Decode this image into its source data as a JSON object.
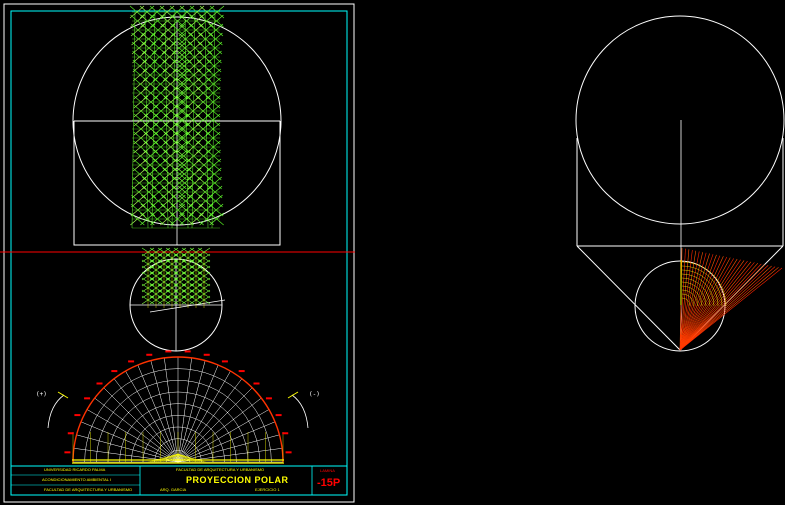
{
  "title_block": {
    "university": "UNIVERSIDAD RICARDO PALMA",
    "course": "ACONDICIONAMIENTO AMBIENTAL I",
    "faculty_line": "FACULTAD DE ARQUITECTURA Y URBANISMO",
    "drawing_title": "PROYECCION POLAR",
    "student_label": "ALUMNO",
    "subject_line": "EJERCICIO 1",
    "sheet_label": "LAMINA",
    "sheet_value": "-15P",
    "author_label": "ARQ. GARCIA"
  },
  "side_labels": {
    "left": "(+)",
    "right": "(-)"
  },
  "colors": {
    "background": "#000000",
    "frame": "#00ffff",
    "line": "#ffffff",
    "mesh": "#66ff33",
    "axis": "#ff0000",
    "arc_yellow": "#ffff00"
  }
}
